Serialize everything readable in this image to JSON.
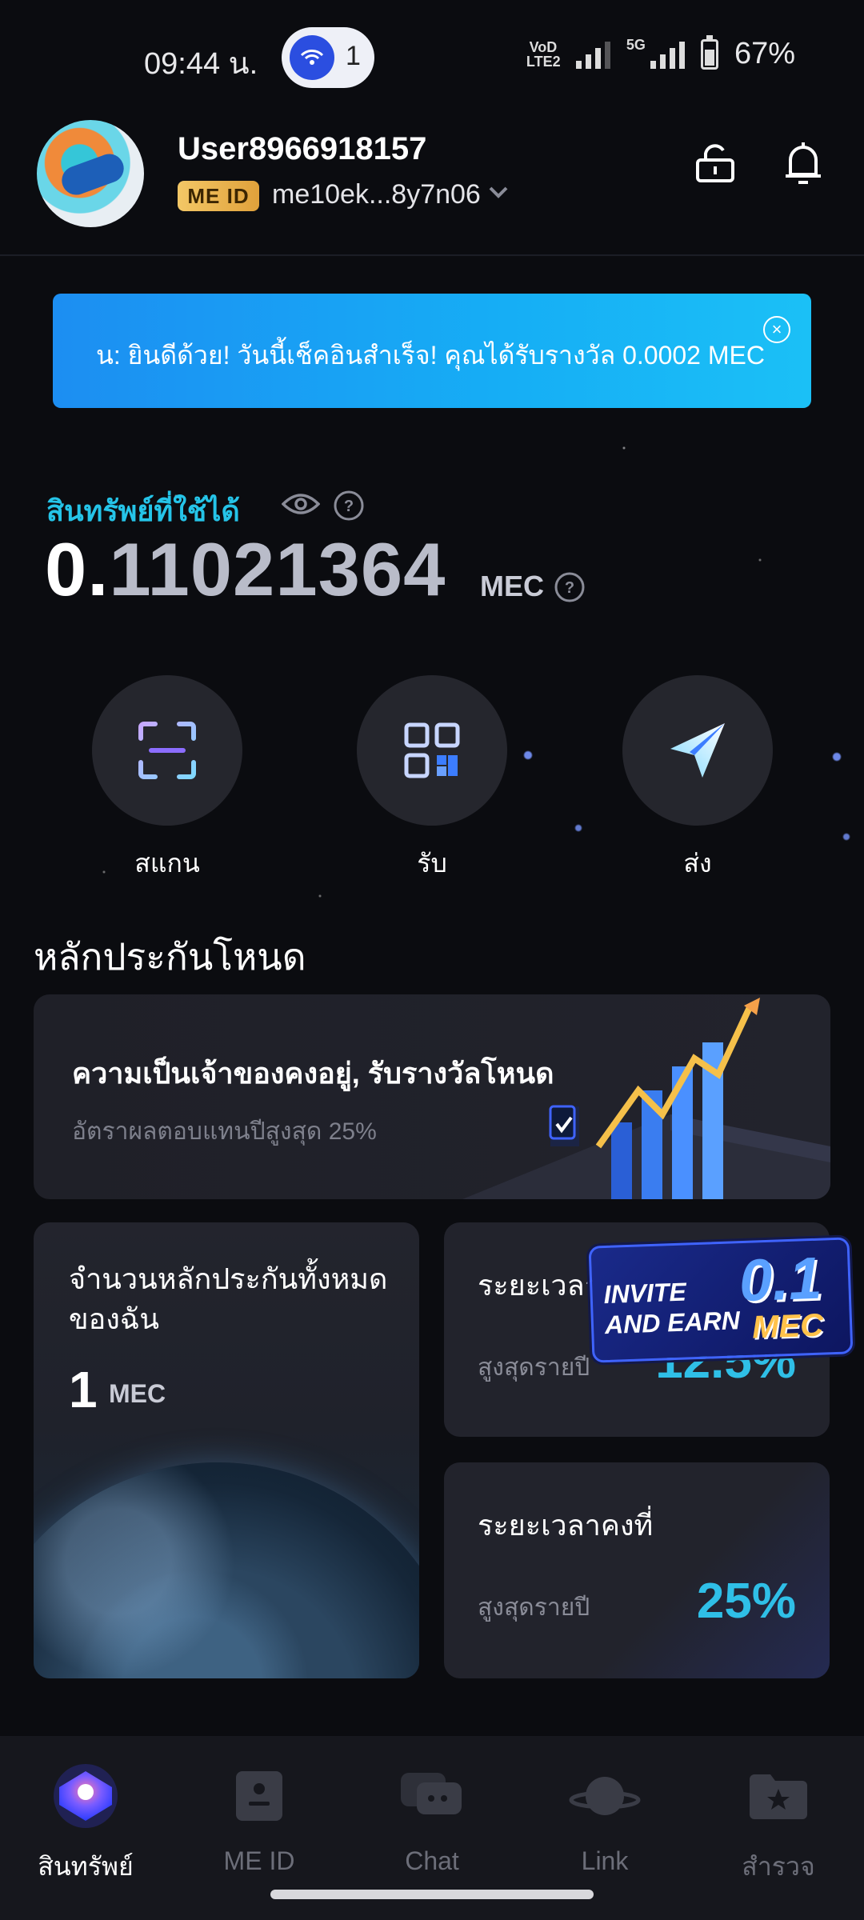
{
  "status_bar": {
    "time": "09:44 น.",
    "hotspot_count": "1",
    "volte_label": "VoD LTE2",
    "net_label": "5G",
    "battery": "67%"
  },
  "header": {
    "username": "User8966918157",
    "badge": "ME ID",
    "address": "me10ek...8y7n06"
  },
  "banner": {
    "text": "น: ยินดีด้วย! วันนี้เช็คอินสำเร็จ! คุณได้รับรางวัล 0.0002 MEC"
  },
  "balance": {
    "label": "สินทรัพย์ที่ใช้ได้",
    "lead_digit": "0.",
    "rest_digits": "11021364",
    "unit": "MEC"
  },
  "actions": [
    {
      "label": "สแกน"
    },
    {
      "label": "รับ"
    },
    {
      "label": "ส่ง"
    }
  ],
  "staking": {
    "section_title": "หลักประกันโหนด",
    "promo_title": "ความเป็นเจ้าของคงอยู่, รับรางวัลโหนด",
    "promo_sub": "อัตราผลตอบแทนปีสูงสุด 25%",
    "total_title": "จำนวนหลักประกันทั้งหมดของฉัน",
    "total_amount": "1",
    "total_unit": "MEC",
    "flex_title": "ระยะเวลา",
    "flex_sub": "สูงสุดรายปี",
    "flex_rate": "12.5%",
    "fixed_title": "ระยะเวลาคงที่",
    "fixed_sub": "สูงสุดรายปี",
    "fixed_rate": "25%"
  },
  "invite": {
    "line1": "INVITE",
    "line2": "AND EARN",
    "amount": "0.1",
    "unit": "MEC"
  },
  "nav": [
    {
      "label": "สินทรัพย์",
      "icon": "assets-icon"
    },
    {
      "label": "ME ID",
      "icon": "id-card-icon"
    },
    {
      "label": "Chat",
      "icon": "chat-icon"
    },
    {
      "label": "Link",
      "icon": "planet-icon"
    },
    {
      "label": "สำรวจ",
      "icon": "explore-folder-icon"
    }
  ],
  "colors": {
    "accent": "#25c4e8",
    "background": "#0b0c10",
    "card": "#22232c",
    "badge_gold": "#f3c766"
  }
}
